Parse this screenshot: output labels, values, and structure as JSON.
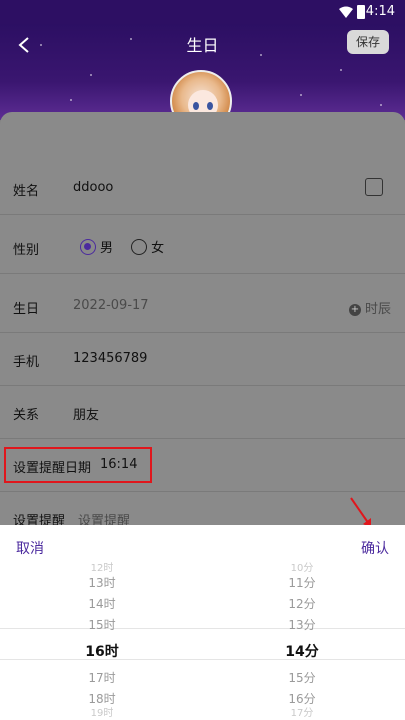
{
  "status_bar": {
    "time": "4:14"
  },
  "header": {
    "title": "生日",
    "save_label": "保存"
  },
  "form": {
    "name": {
      "label": "姓名",
      "value": "ddooo"
    },
    "gender": {
      "label": "性别",
      "options": [
        "男",
        "女"
      ],
      "selected": "男"
    },
    "birthday": {
      "label": "生日",
      "value": "2022-09-17",
      "shichen_label": "时辰"
    },
    "phone": {
      "label": "手机",
      "value": "123456789"
    },
    "relation": {
      "label": "关系",
      "value": "朋友"
    },
    "reminder_date": {
      "label": "设置提醒日期",
      "value": "16:14"
    },
    "reminder": {
      "label": "设置提醒",
      "placeholder": "设置提醒"
    }
  },
  "picker": {
    "cancel_label": "取消",
    "confirm_label": "确认",
    "hours": {
      "above_partial": "12时",
      "above": [
        "13时",
        "14时",
        "15时"
      ],
      "selected": "16时",
      "below": [
        "17时",
        "18时"
      ],
      "below_partial": "19时"
    },
    "minutes": {
      "above_partial": "10分",
      "above": [
        "11分",
        "12分",
        "13分"
      ],
      "selected": "14分",
      "below": [
        "15分",
        "16分"
      ],
      "below_partial": "17分"
    }
  }
}
